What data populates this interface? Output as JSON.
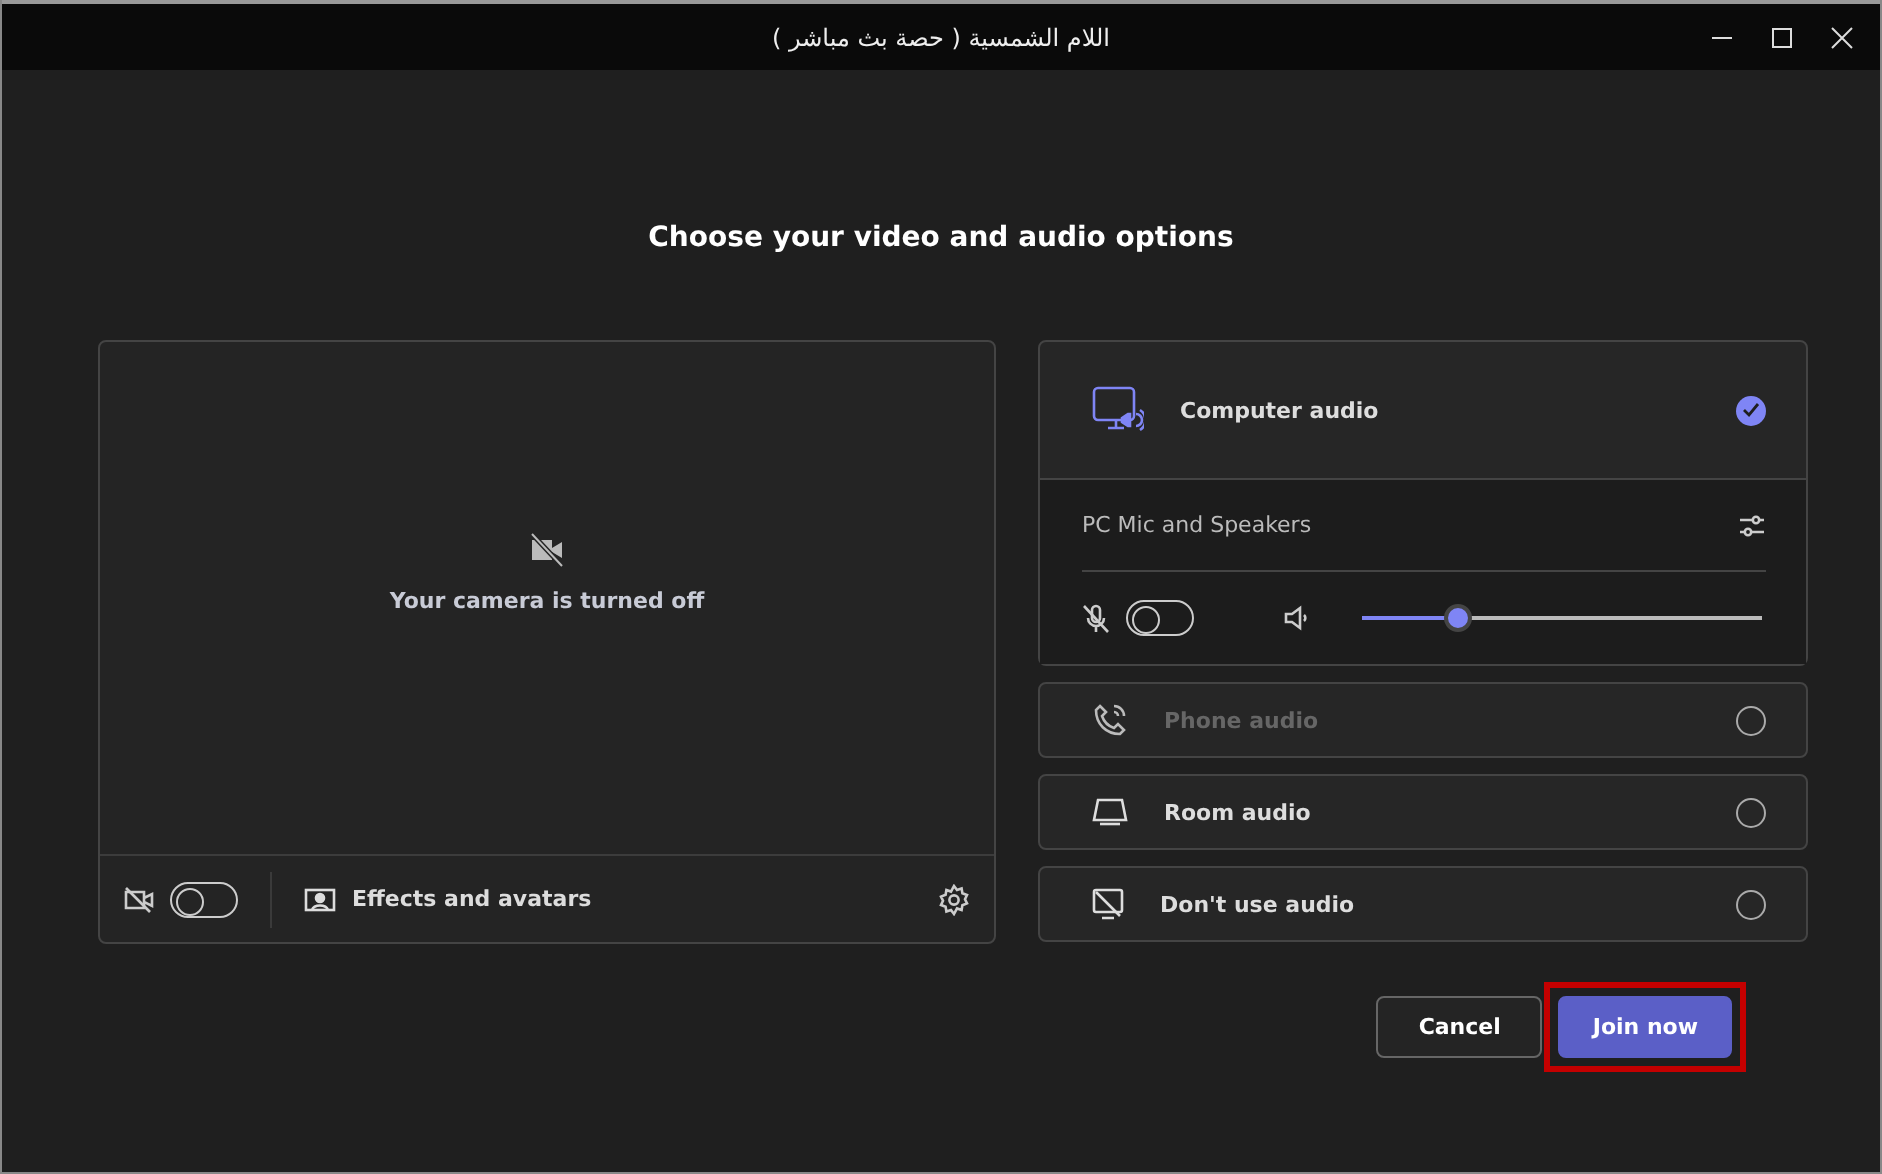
{
  "window": {
    "title": "اللام الشمسية ( حصة بث مباشر )"
  },
  "heading": "Choose your video and audio options",
  "video": {
    "message": "Your camera is turned off",
    "camera_on": false,
    "effects_label": "Effects and avatars"
  },
  "audio_options": [
    {
      "kind": "computer",
      "label": "Computer audio",
      "selected": true,
      "disabled": false,
      "device": "PC Mic and Speakers",
      "mic_on": false,
      "volume": {
        "level": 0.24
      }
    },
    {
      "kind": "phone",
      "label": "Phone audio",
      "selected": false,
      "disabled": true
    },
    {
      "kind": "room",
      "label": "Room audio",
      "selected": false,
      "disabled": false
    },
    {
      "kind": "none",
      "label": "Don't use audio",
      "selected": false,
      "disabled": false
    }
  ],
  "buttons": [
    {
      "kind": "secondary",
      "label": "Cancel",
      "highlighted": false
    },
    {
      "kind": "primary",
      "label": "Join now",
      "highlighted": true
    }
  ]
}
